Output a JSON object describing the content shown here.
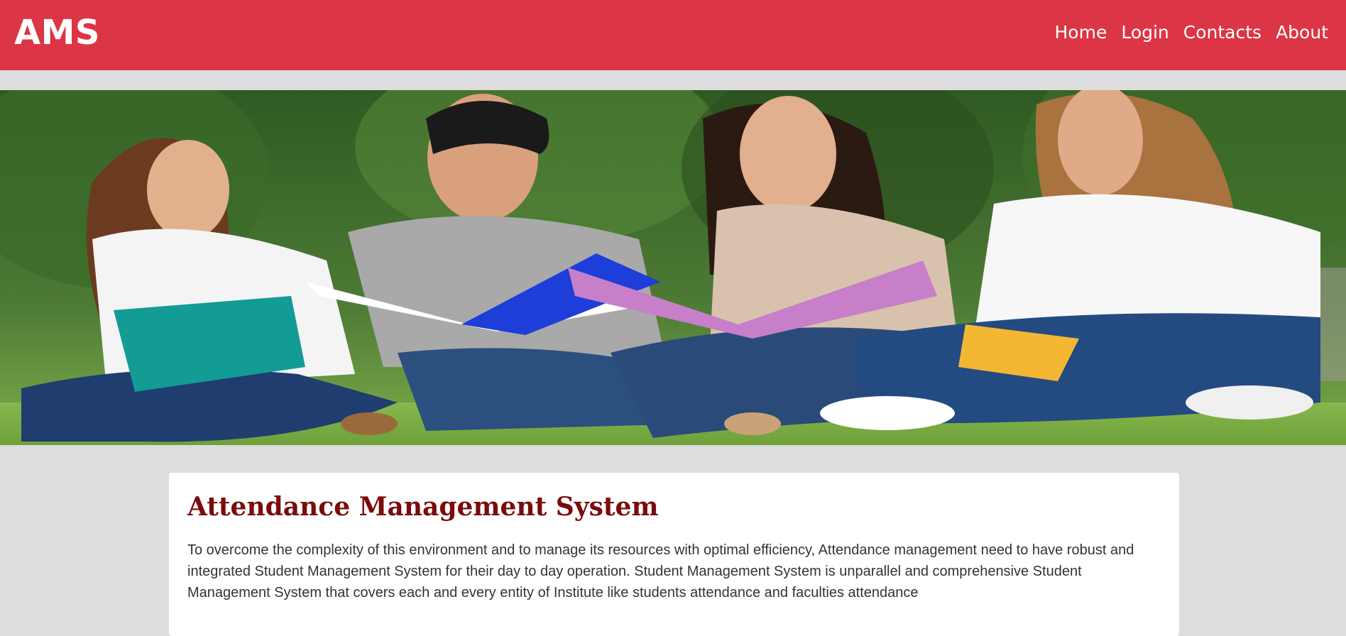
{
  "navbar": {
    "brand": "AMS",
    "background_color": "#dc3545",
    "links": [
      {
        "label": "Home"
      },
      {
        "label": "Login"
      },
      {
        "label": "Contacts"
      },
      {
        "label": "About"
      }
    ]
  },
  "hero": {
    "image_subject": "students sitting on grass with notebooks"
  },
  "content": {
    "title": "Attendance Management System",
    "title_color": "#7b0b0b",
    "paragraph": "To overcome the complexity of this environment and to manage its resources with optimal efficiency, Attendance management need to have robust and integrated Student Management System for their day to day operation. Student Management System is unparallel and comprehensive Student Management System that covers each and every entity of Institute like students attendance and faculties attendance"
  }
}
